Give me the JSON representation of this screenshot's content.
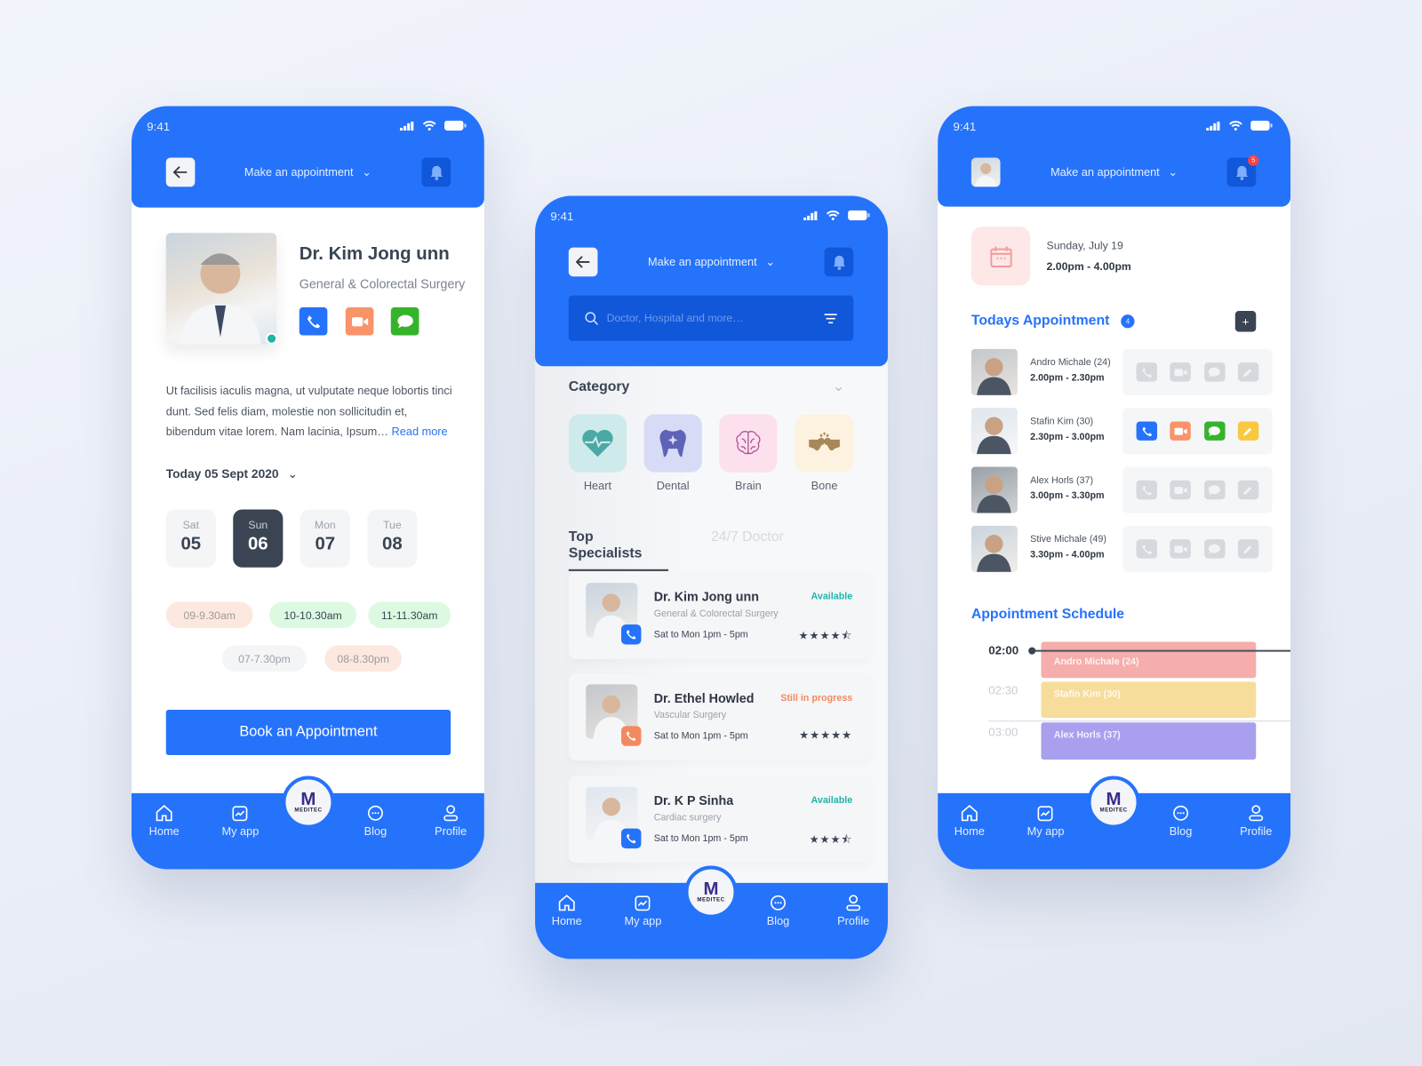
{
  "status_time": "9:41",
  "header_title": "Make an appointment",
  "colors": {
    "primary": "#2573fb",
    "dark": "#3a4453",
    "available": "#1eb5a8",
    "in_progress": "#f4895f",
    "phone": "#2573fb",
    "video": "#f9936a",
    "chat": "#35b42b",
    "edit": "#f9c840"
  },
  "nav": {
    "home": "Home",
    "myapp": "My app",
    "blog": "Blog",
    "profile": "Profile",
    "logo_letter": "M",
    "logo_text": "MEDITEC"
  },
  "doctor_screen": {
    "name": "Dr. Kim Jong unn",
    "specialty": "General & Colorectal Surgery",
    "online": true,
    "bio": "Ut facilisis iaculis magna, ut vulputate neque lobortis tinci dunt. Sed felis diam, molestie non sollicitudin et, bibendum vitae lorem. Nam lacinia, Ipsum…",
    "read_more": "Read more",
    "date_label": "Today 05 Sept 2020",
    "days": [
      {
        "dow": "Sat",
        "num": "05"
      },
      {
        "dow": "Sun",
        "num": "06",
        "selected": true
      },
      {
        "dow": "Mon",
        "num": "07"
      },
      {
        "dow": "Tue",
        "num": "08"
      }
    ],
    "slots": [
      {
        "label": "09-9.30am",
        "state": "booked"
      },
      {
        "label": "10-10.30am",
        "state": "available"
      },
      {
        "label": "11-11.30am",
        "state": "available"
      },
      {
        "label": "07-7.30pm",
        "state": "disabled"
      },
      {
        "label": "08-8.30pm",
        "state": "booked"
      }
    ],
    "book_button": "Book an Appointment"
  },
  "search_screen": {
    "search_placeholder": "Doctor, Hospital and more…",
    "category_title": "Category",
    "categories": [
      "Heart",
      "Dental",
      "Brain",
      "Bone"
    ],
    "tabs": [
      "Top Specialists",
      "24/7 Doctor"
    ],
    "active_tab": "Top Specialists",
    "specialists": [
      {
        "name": "Dr. Kim Jong unn",
        "specialty": "General & Colorectal Surgery",
        "hours": "Sat to Mon 1pm - 5pm",
        "status": "Available",
        "rating": 4.5
      },
      {
        "name": "Dr. Ethel Howled",
        "specialty": "Vascular Surgery",
        "hours": "Sat to Mon 1pm - 5pm",
        "status": "Still in progress",
        "rating": 5
      },
      {
        "name": "Dr. K P Sinha",
        "specialty": "Cardiac surgery",
        "hours": "Sat to Mon 1pm - 5pm",
        "status": "Available",
        "rating": 3.5
      }
    ]
  },
  "schedule_screen": {
    "notification_count": "5",
    "date": "Sunday, July 19",
    "time_range": "2.00pm - 4.00pm",
    "todays_title": "Todays Appointment",
    "todays_count": "4",
    "add_label": "+",
    "appointments": [
      {
        "name": "Andro Michale (24)",
        "time": "2.00pm - 2.30pm",
        "active": false
      },
      {
        "name": "Stafin Kim (30)",
        "time": "2.30pm - 3.00pm",
        "active": true
      },
      {
        "name": "Alex Horls (37)",
        "time": "3.00pm - 3.30pm",
        "active": false
      },
      {
        "name": "Stive Michale (49)",
        "time": "3.30pm - 4.00pm",
        "active": false
      }
    ],
    "schedule_title": "Appointment Schedule",
    "times": [
      "02:00",
      "02:30",
      "03:00"
    ],
    "blocks": [
      {
        "label": "Andro Michale (24)",
        "color": "#f5aeab"
      },
      {
        "label": "Stafin Kim (30)",
        "color": "#f7dd9b"
      },
      {
        "label": "Alex Horls (37)",
        "color": "#a8a0ef"
      }
    ]
  }
}
